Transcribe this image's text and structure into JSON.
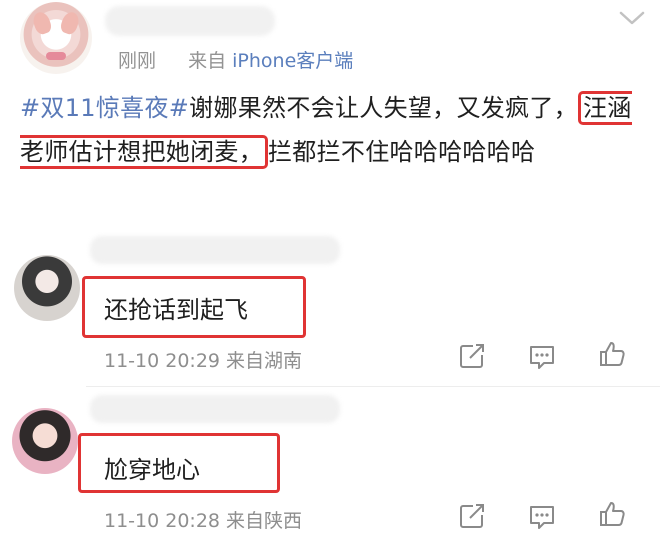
{
  "post": {
    "time": "刚刚",
    "source_prefix": "来自 ",
    "source": "iPhone客户端",
    "text": {
      "topic": "#双11惊喜夜#",
      "part1": "谢娜果然不会让人失望，又发疯了，",
      "highlight": "汪涵老师估计想把她闭麦，",
      "part2": "拦都拦不住哈哈哈哈哈哈"
    }
  },
  "comments": [
    {
      "text": "还抢话到起飞",
      "meta": "11-10 20:29 来自湖南"
    },
    {
      "text": "尬穿地心",
      "meta": "11-10 20:28 来自陕西"
    }
  ],
  "icons": [
    "chevron-down-icon",
    "share-icon",
    "comment-icon",
    "like-icon"
  ],
  "colors": {
    "topic": "#5a7ab8",
    "highlight_border": "#e03434",
    "meta_gray": "#8e8e8e"
  }
}
